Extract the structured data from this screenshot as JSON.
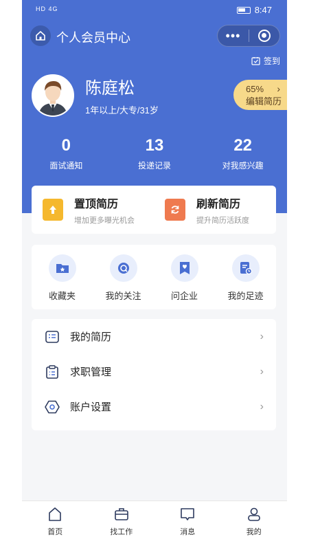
{
  "status_bar": {
    "network": "HD 4G",
    "time": "8:47"
  },
  "navbar": {
    "title": "个人会员中心",
    "menu_dots": "•••"
  },
  "checkin": {
    "label": "签到"
  },
  "profile": {
    "name": "陈庭松",
    "info": "1年以上/大专/31岁"
  },
  "resume_pill": {
    "percent": "65%",
    "label": "编辑简历",
    "arrow": "›"
  },
  "stats": [
    {
      "value": "0",
      "label": "面试通知"
    },
    {
      "value": "13",
      "label": "投递记录"
    },
    {
      "value": "22",
      "label": "对我感兴趣"
    }
  ],
  "quick_actions": [
    {
      "title": "置顶简历",
      "subtitle": "增加更多曝光机会",
      "icon": "top-icon",
      "color": "#f5b82e"
    },
    {
      "title": "刷新简历",
      "subtitle": "提升简历活跃度",
      "icon": "refresh-icon",
      "color": "#ef7a4f"
    }
  ],
  "shortcuts": [
    {
      "label": "收藏夹",
      "icon": "folder-star-icon"
    },
    {
      "label": "我的关注",
      "icon": "follow-icon"
    },
    {
      "label": "问企业",
      "icon": "ask-company-icon"
    },
    {
      "label": "我的足迹",
      "icon": "footprint-icon"
    }
  ],
  "menu": [
    {
      "label": "我的简历",
      "icon": "resume-icon"
    },
    {
      "label": "求职管理",
      "icon": "clipboard-icon"
    },
    {
      "label": "账户设置",
      "icon": "settings-icon"
    }
  ],
  "tabbar": [
    {
      "label": "首页",
      "icon": "home-icon"
    },
    {
      "label": "找工作",
      "icon": "briefcase-icon"
    },
    {
      "label": "消息",
      "icon": "message-icon"
    },
    {
      "label": "我的",
      "icon": "user-icon"
    }
  ],
  "colors": {
    "primary": "#4a6fd2",
    "pill": "#f7d98a",
    "icon_tint": "#4a6fd2"
  }
}
